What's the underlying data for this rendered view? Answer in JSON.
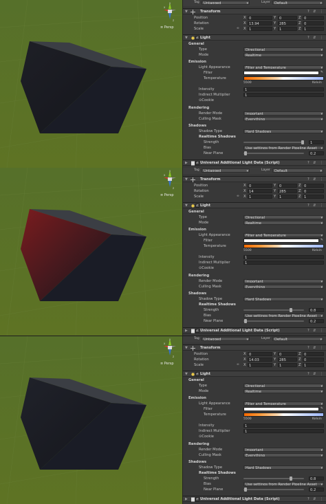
{
  "colors": {
    "ground": "#5b7126",
    "inspector_bg": "#383838",
    "header_bg": "#3e3e3e",
    "accent_blue": "#3a72c4"
  },
  "gizmo": {
    "persp_label": "≡ Persp",
    "y_axis": "y",
    "x_axis": "x",
    "z_axis": "z"
  },
  "panels": [
    {
      "cube_side_tint": "#1e1f26",
      "top": {
        "tag_label": "Tag",
        "tag_value": "Untagged",
        "layer_label": "Layer",
        "layer_value": "Default"
      },
      "transform": {
        "title": "Transform",
        "position": {
          "label": "Position",
          "x": "0",
          "y": "0",
          "z": "0"
        },
        "rotation": {
          "label": "Rotation",
          "x": "13.94",
          "y": "285",
          "z": "0"
        },
        "scale": {
          "label": "Scale",
          "x": "1",
          "y": "1",
          "z": "1"
        }
      },
      "light": {
        "title": "Light",
        "general": "General",
        "type_label": "Type",
        "type_value": "Directional",
        "mode_label": "Mode",
        "mode_value": "Realtime",
        "emission": "Emission",
        "appearance_label": "Light Appearance",
        "appearance_value": "Filter and Temperature",
        "filter_label": "Filter",
        "temperature_label": "Temperature",
        "temp_value": "5500",
        "temp_unit": "Kelvin",
        "intensity_label": "Intensity",
        "intensity_value": "1",
        "indirect_label": "Indirect Multiplier",
        "indirect_value": "1",
        "cookie_label": "Cookie",
        "rendering": "Rendering",
        "render_mode_label": "Render Mode",
        "render_mode_value": "Important",
        "culling_label": "Culling Mask",
        "culling_value": "Everything",
        "shadows": "Shadows",
        "shadow_type_label": "Shadow Type",
        "shadow_type_value": "Hard Shadows",
        "realtime_shadows": "Realtime Shadows",
        "strength_label": "Strength",
        "strength_value": "1",
        "bias_label": "Bias",
        "bias_value": "Use settings from Render Pipeline Asset",
        "near_label": "Near Plane",
        "near_value": "0.2"
      },
      "additional": {
        "title": "Universal Additional Light Data (Script)"
      }
    },
    {
      "cube_side_tint": "#7a1c1f",
      "top": {
        "tag_label": "Tag",
        "tag_value": "Untagged",
        "layer_label": "Layer",
        "layer_value": "Default"
      },
      "transform": {
        "title": "Transform",
        "position": {
          "label": "Position",
          "x": "0",
          "y": "0",
          "z": "0"
        },
        "rotation": {
          "label": "Rotation",
          "x": "14",
          "y": "285",
          "z": "0"
        },
        "scale": {
          "label": "Scale",
          "x": "1",
          "y": "1",
          "z": "1"
        }
      },
      "light": {
        "title": "Light",
        "general": "General",
        "type_label": "Type",
        "type_value": "Directional",
        "mode_label": "Mode",
        "mode_value": "Realtime",
        "emission": "Emission",
        "appearance_label": "Light Appearance",
        "appearance_value": "Filter and Temperature",
        "filter_label": "Filter",
        "temperature_label": "Temperature",
        "temp_value": "5500",
        "temp_unit": "Kelvin",
        "intensity_label": "Intensity",
        "intensity_value": "1",
        "indirect_label": "Indirect Multiplier",
        "indirect_value": "1",
        "cookie_label": "Cookie",
        "rendering": "Rendering",
        "render_mode_label": "Render Mode",
        "render_mode_value": "Important",
        "culling_label": "Culling Mask",
        "culling_value": "Everything",
        "shadows": "Shadows",
        "shadow_type_label": "Shadow Type",
        "shadow_type_value": "Hard Shadows",
        "realtime_shadows": "Realtime Shadows",
        "strength_label": "Strength",
        "strength_value": "0.8",
        "bias_label": "Bias",
        "bias_value": "Use settings from Render Pipeline Asset",
        "near_label": "Near Plane",
        "near_value": "0.2"
      },
      "additional": {
        "title": "Universal Additional Light Data (Script)"
      }
    },
    {
      "cube_side_tint": "#20222a",
      "top": {
        "tag_label": "Tag",
        "tag_value": "Untagged",
        "layer_label": "Layer",
        "layer_value": "Default"
      },
      "transform": {
        "title": "Transform",
        "position": {
          "label": "Position",
          "x": "0",
          "y": "0",
          "z": "0"
        },
        "rotation": {
          "label": "Rotation",
          "x": "14.03",
          "y": "285",
          "z": "0"
        },
        "scale": {
          "label": "Scale",
          "x": "1",
          "y": "1",
          "z": "1"
        }
      },
      "light": {
        "title": "Light",
        "general": "General",
        "type_label": "Type",
        "type_value": "Directional",
        "mode_label": "Mode",
        "mode_value": "Realtime",
        "emission": "Emission",
        "appearance_label": "Light Appearance",
        "appearance_value": "Filter and Temperature",
        "filter_label": "Filter",
        "temperature_label": "Temperature",
        "temp_value": "5500",
        "temp_unit": "Kelvin",
        "intensity_label": "Intensity",
        "intensity_value": "1",
        "indirect_label": "Indirect Multiplier",
        "indirect_value": "1",
        "cookie_label": "Cookie",
        "rendering": "Rendering",
        "render_mode_label": "Render Mode",
        "render_mode_value": "Important",
        "culling_label": "Culling Mask",
        "culling_value": "Everything",
        "shadows": "Shadows",
        "shadow_type_label": "Shadow Type",
        "shadow_type_value": "Hard Shadows",
        "realtime_shadows": "Realtime Shadows",
        "strength_label": "Strength",
        "strength_value": "0.8",
        "bias_label": "Bias",
        "bias_value": "Use settings from Render Pipeline Asset",
        "near_label": "Near Plane",
        "near_value": "0.2"
      },
      "additional": {
        "title": "Universal Additional Light Data (Script)"
      }
    }
  ]
}
